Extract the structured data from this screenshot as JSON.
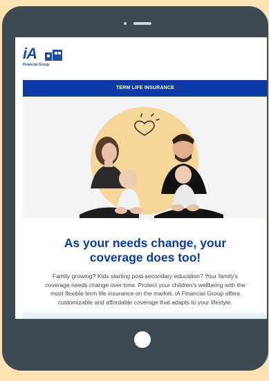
{
  "logo": {
    "brand": "iA",
    "subtitle": "Financial Group"
  },
  "banner": {
    "label": "TERM LIFE INSURANCE"
  },
  "headline": {
    "line1": "As your needs change, your",
    "line2": "coverage does too!"
  },
  "body": {
    "lines": [
      "Family growing? Kids starting post-secondary education? Your family's",
      "coverage needs change over time. Protect your children's wellbeing with the",
      "most flexible term life insurance on the market. iA Financial Group offers",
      "customizable and affordable coverage that adapts to your lifestyle."
    ]
  },
  "colors": {
    "page_background": "#fde2b3",
    "tablet_frame": "#3d4a54",
    "brand_blue": "#0b3aa6",
    "hero_circle": "#f7d69a",
    "body_text": "#444444",
    "light_strip": "#e6f3fa"
  },
  "icons": {
    "heart": "heart-icon",
    "home_button": "home-button",
    "camera": "camera-icon"
  }
}
